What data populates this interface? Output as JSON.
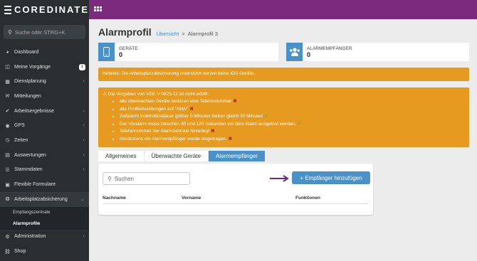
{
  "brand": {
    "name": "COREDINATE"
  },
  "sidebar": {
    "search_placeholder": "Suche oder STRG+K",
    "items": [
      {
        "label": "Dashboard",
        "icon": "tachometer-icon"
      },
      {
        "label": "Meine Vorgänge",
        "icon": "inbox-icon",
        "badge": "1"
      },
      {
        "label": "Dienstplanung",
        "icon": "calendar-icon"
      },
      {
        "label": "Mitteilungen",
        "icon": "envelope-icon"
      },
      {
        "label": "Arbeitsergebnisse",
        "icon": "thumbs-up-icon"
      },
      {
        "label": "GPS",
        "icon": "map-marker-icon"
      },
      {
        "label": "Zeiten",
        "icon": "clock-icon"
      },
      {
        "label": "Auswertungen",
        "icon": "bar-chart-icon"
      },
      {
        "label": "Stammdaten",
        "icon": "list-icon"
      },
      {
        "label": "Flexible Formulare",
        "icon": "form-icon"
      },
      {
        "label": "Arbeitsplatzabsicherung",
        "icon": "support-icon"
      }
    ],
    "subitems": [
      {
        "label": "Empfangszentrale"
      },
      {
        "label": "Alarmprofile"
      }
    ],
    "bottom_items": [
      {
        "label": "Administration",
        "icon": "cogs-icon"
      },
      {
        "label": "Shop",
        "icon": "shopping-cart-icon"
      }
    ]
  },
  "header": {
    "title": "Alarmprofil",
    "breadcrumb_link": "Übersicht",
    "breadcrumb_sep": ">",
    "breadcrumb_current": "Alarmprofil 3"
  },
  "stats": {
    "devices": {
      "label": "GERÄTE",
      "value": "0"
    },
    "recipients": {
      "label": "ALARMEMPFÄNGER",
      "value": "0"
    }
  },
  "alerts": {
    "hint": "Hinweis: Die Arbeitsplatzabsicherung unterstützt derzeit keine iOS Geräte.",
    "norm_title": "Die Vorgaben von VDE V 0825-11 ist nicht erfüllt:",
    "norm_items": [
      {
        "text": "alle überwachten Geräte besitzen eine Telefonnummer",
        "ok": false
      },
      {
        "text": "alle Profileinstellungen auf \"Aktiv\"",
        "ok": false
      },
      {
        "text": "Zeitalarm Inaktivitätsdauer größer 5 Minuten kleiner gleich 30 Minuten",
        "ok": true
      },
      {
        "text": "Der Voralarm muss zwischen 30 und 120 Sekunden vor dem Alarm ausgelöst werden.",
        "ok": true
      },
      {
        "text": "Telefonnummer der Alarmzentrale hinterlegt",
        "ok": false
      },
      {
        "text": "mindestens ein Alarmempfänger wurde eingetragen.",
        "ok": false
      }
    ]
  },
  "tabs": [
    "Allgemeines",
    "Überwachte Geräte",
    "Alarmempfänger"
  ],
  "panel": {
    "search_placeholder": "Suchen",
    "add_button": "+ Empfänger hinzufügen",
    "columns": [
      "Nachname",
      "Vorname",
      "Funktionen"
    ]
  },
  "colors": {
    "topbar": "#7b2a7e",
    "sidebar": "#2a2e31",
    "accent": "#4a90c9",
    "warning": "#e69a1f",
    "arrow": "#6b2a7a"
  }
}
